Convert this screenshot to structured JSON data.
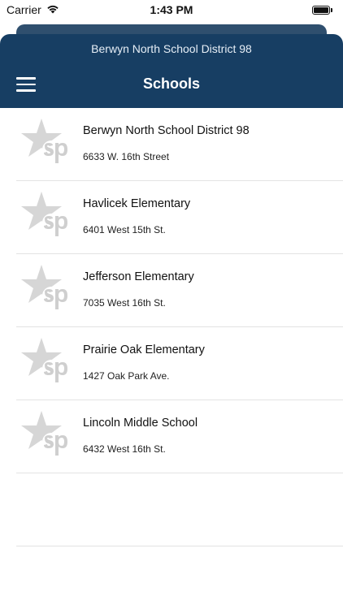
{
  "status_bar": {
    "carrier": "Carrier",
    "time": "1:43 PM"
  },
  "header": {
    "district_name": "Berwyn North School District 98",
    "title": "Schools",
    "background_color": "#173e63"
  },
  "schools": [
    {
      "name": "Berwyn North School District 98",
      "address": "6633 W. 16th Street",
      "icon": "sp-star-logo-icon"
    },
    {
      "name": "Havlicek Elementary",
      "address": "6401 West 15th St.",
      "icon": "sp-star-logo-icon"
    },
    {
      "name": "Jefferson Elementary",
      "address": "7035 West 16th St.",
      "icon": "sp-star-logo-icon"
    },
    {
      "name": "Prairie Oak Elementary",
      "address": "1427 Oak Park Ave.",
      "icon": "sp-star-logo-icon"
    },
    {
      "name": "Lincoln Middle School",
      "address": "6432 West 16th St.",
      "icon": "sp-star-logo-icon"
    }
  ]
}
